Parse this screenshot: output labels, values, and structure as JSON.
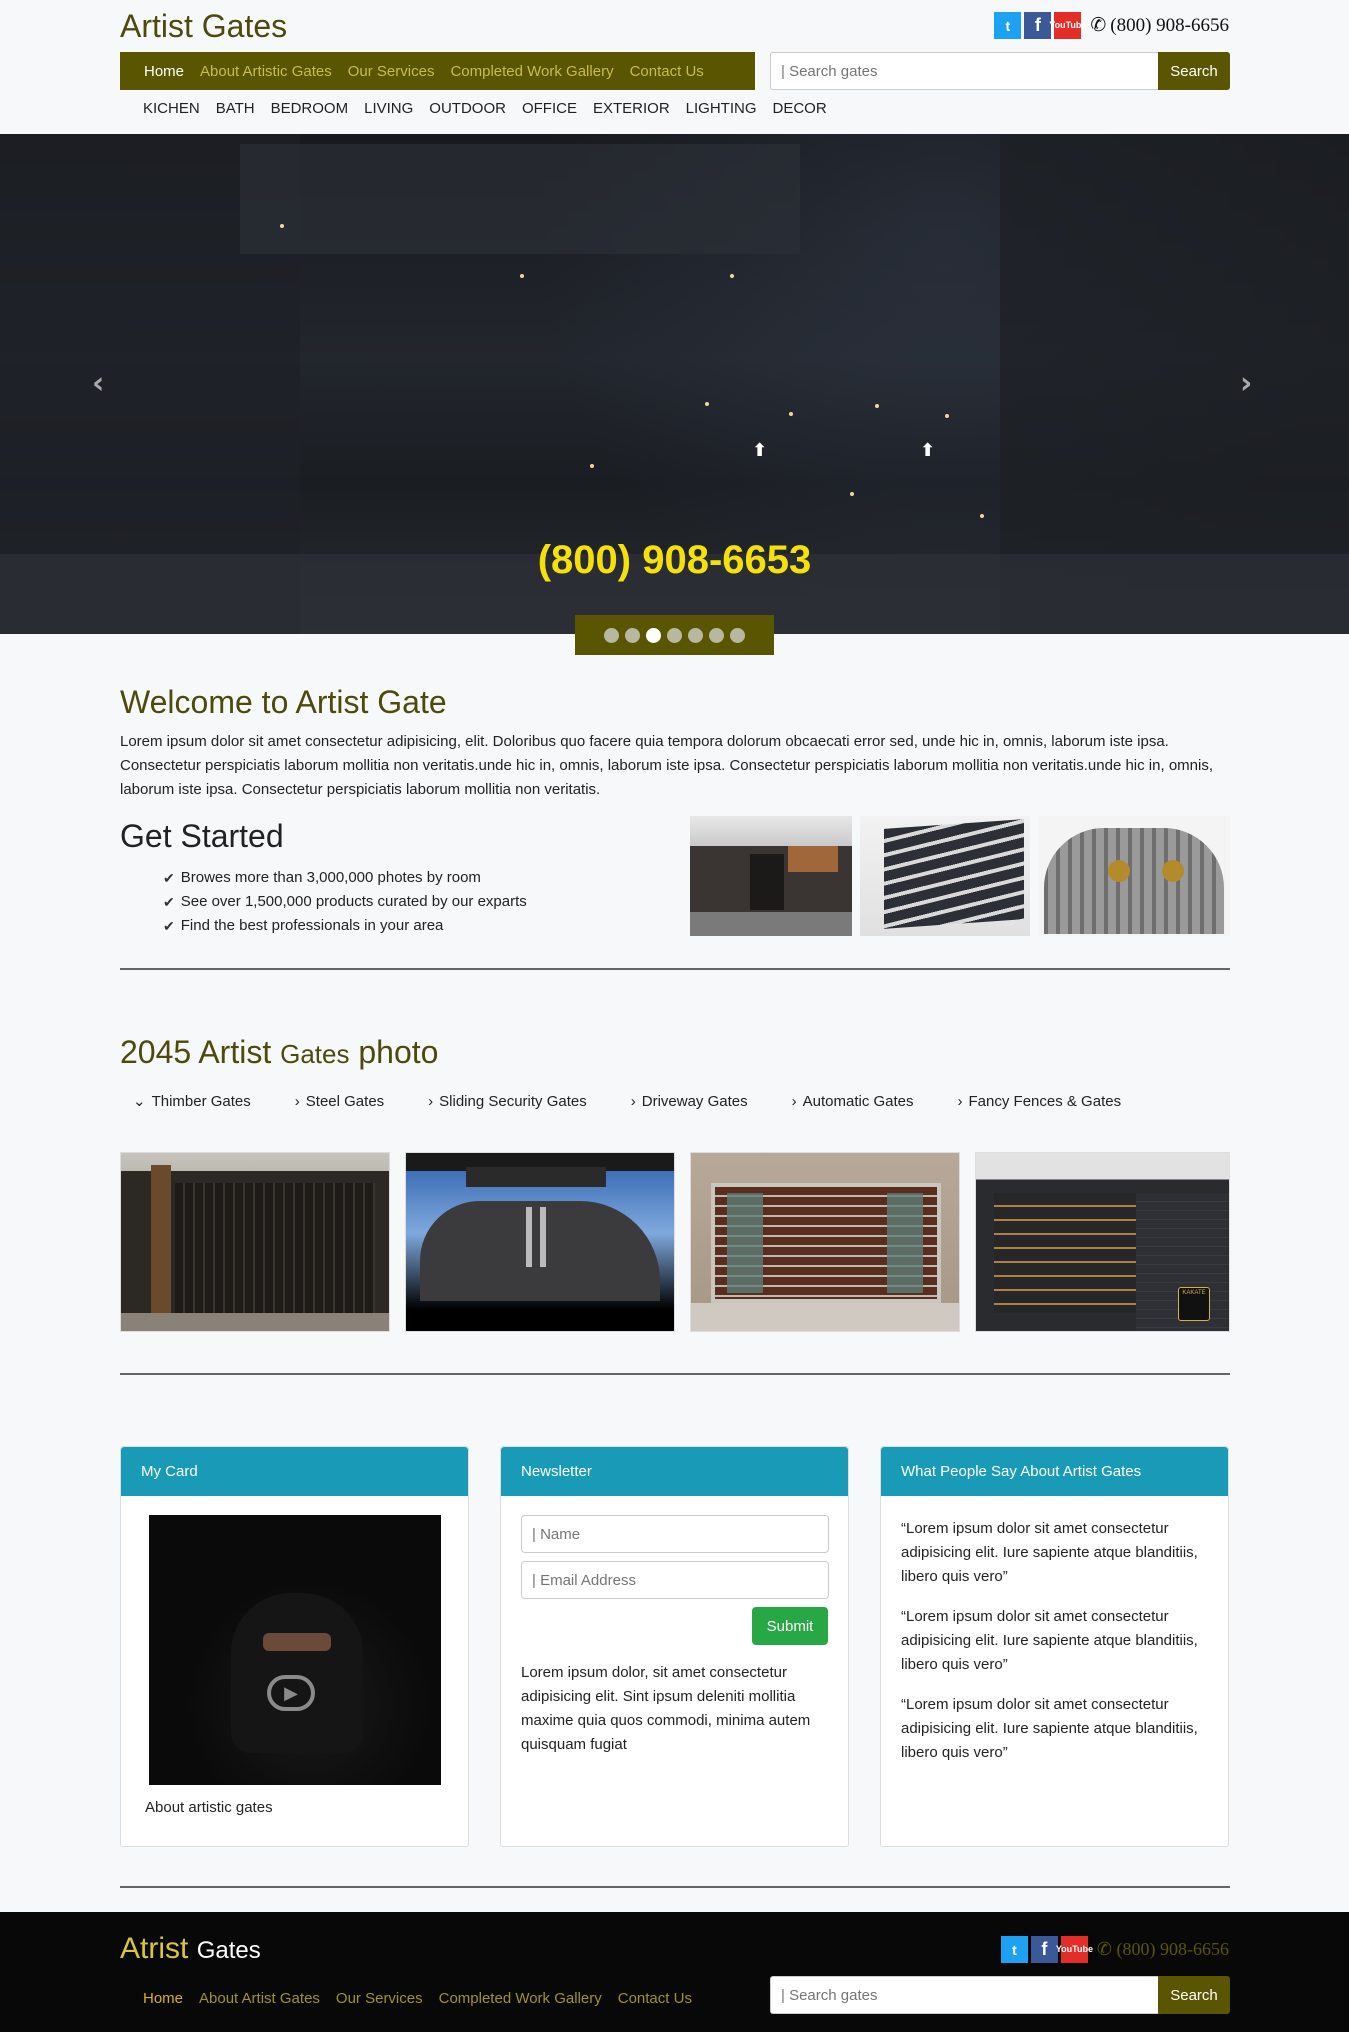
{
  "header": {
    "brand": "Artist Gates",
    "phone": "(800) 908-6656",
    "nav": [
      "Home",
      "About Artistic Gates",
      "Our Services",
      "Completed Work Gallery",
      "Contact Us"
    ],
    "search_placeholder": "| Search gates",
    "search_button": "Search",
    "subnav": [
      "KICHEN",
      "BATH",
      "BEDROOM",
      "LIVING",
      "OUTDOOR",
      "OFFICE",
      "EXTERIOR",
      "LIGHTING",
      "DECOR"
    ],
    "social": {
      "twitter": "t",
      "facebook": "f",
      "youtube_top": "You",
      "youtube_bottom": "Tube"
    }
  },
  "hero": {
    "phone": "(800) 908-6653",
    "slide_count": 7,
    "active_slide": 3,
    "prev": "‹",
    "next": "›"
  },
  "welcome": {
    "title": "Welcome to Artist Gate",
    "text": "Lorem ipsum dolor sit amet consectetur adipisicing, elit. Doloribus quo facere quia tempora dolorum obcaecati error sed, unde hic in, omnis, laborum iste ipsa. Consectetur perspiciatis laborum mollitia non veritatis.unde hic in, omnis, laborum iste ipsa. Consectetur perspiciatis laborum mollitia non veritatis.unde hic in, omnis, laborum iste ipsa. Consectetur perspiciatis laborum mollitia non veritatis."
  },
  "get_started": {
    "title": "Get Started",
    "items": [
      "Browes more than 3,000,000 photes by room",
      "See over 1,500,000 products curated by our exparts",
      "Find the best professionals in your area"
    ]
  },
  "photos": {
    "title_count": "2045 Artist",
    "title_mid": "Gates",
    "title_end": "photo",
    "categories": [
      "Thimber Gates",
      "Steel Gates",
      "Sliding Security Gates",
      "Driveway Gates",
      "Automatic Gates",
      "Fancy Fences & Gates"
    ],
    "badge_text": "KAKATE"
  },
  "cards": {
    "my_card": {
      "title": "My Card",
      "caption": "About artistic gates"
    },
    "newsletter": {
      "title": "Newsletter",
      "name_placeholder": "| Name",
      "email_placeholder": "| Email Address",
      "submit": "Submit",
      "text": "Lorem ipsum dolor, sit amet consectetur adipisicing elit. Sint ipsum deleniti mollitia maxime quia quos commodi, minima autem quisquam fugiat"
    },
    "testimonials": {
      "title": "What People Say About Artist Gates",
      "quotes": [
        "“Lorem ipsum dolor sit amet consectetur adipisicing elit. Iure sapiente atque blanditiis, libero quis vero”",
        "“Lorem ipsum dolor sit amet consectetur adipisicing elit. Iure sapiente atque blanditiis, libero quis vero”",
        "“Lorem ipsum dolor sit amet consectetur adipisicing elit. Iure sapiente atque blanditiis, libero quis vero”"
      ]
    }
  },
  "footer": {
    "brand_a": "Atrist",
    "brand_b": "Gates",
    "phone": "(800) 908-6656",
    "nav": [
      "Home",
      "About Artist Gates",
      "Our Services",
      "Completed Work Gallery",
      "Contact Us"
    ],
    "search_placeholder": "| Search gates",
    "search_button": "Search"
  },
  "colors": {
    "brand_olive": "#595500",
    "nav_link": "#c8bd4a",
    "card_header": "#199bb7",
    "submit_green": "#28a745",
    "hero_phone": "#f5e10a"
  }
}
